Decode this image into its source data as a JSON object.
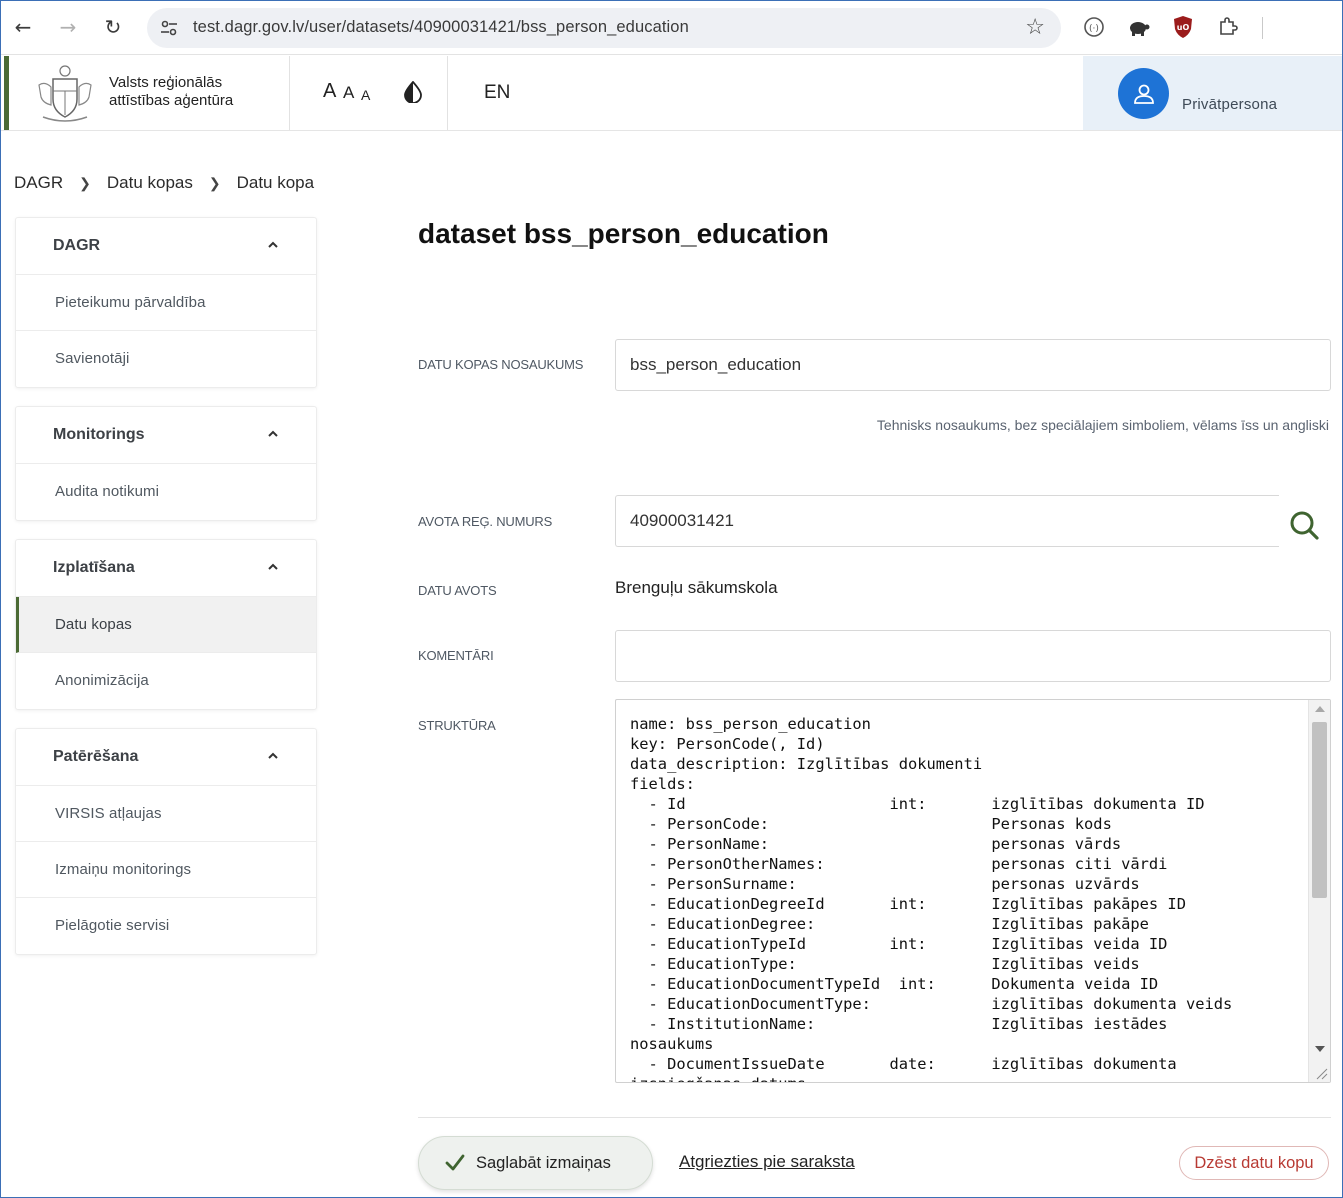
{
  "browser": {
    "url": "test.dagr.gov.lv/user/datasets/40900031421/bss_person_education"
  },
  "header": {
    "org_line1": "Valsts reģionālās",
    "org_line2": "attīstības aģentūra",
    "font_small": "A",
    "font_medium": "A",
    "font_large": "A",
    "language": "EN",
    "user_role": "Privātpersona"
  },
  "breadcrumb": [
    "DAGR",
    "Datu kopas",
    "Datu kopa"
  ],
  "sidebar": {
    "groups": [
      {
        "title": "DAGR",
        "items": [
          "Pieteikumu pārvaldība",
          "Savienotāji"
        ]
      },
      {
        "title": "Monitorings",
        "items": [
          "Audita notikumi"
        ]
      },
      {
        "title": "Izplatīšana",
        "items": [
          "Datu kopas",
          "Anonimizācija"
        ],
        "active": "Datu kopas"
      },
      {
        "title": "Patērēšana",
        "items": [
          "VIRSIS atļaujas",
          "Izmaiņu monitorings",
          "Pielāgotie servisi"
        ]
      }
    ]
  },
  "main": {
    "title": "dataset bss_person_education",
    "name_label": "DATU KOPAS NOSAUKUMS",
    "name_value": "bss_person_education",
    "name_hint": "Tehnisks nosaukums, bez speciālajiem simboliem, vēlams īss un angliski",
    "reg_label": "AVOTA REĢ. NUMURS",
    "reg_value": "40900031421",
    "source_label": "DATU AVOTS",
    "source_value": "Brenguļu sākumskola",
    "comments_label": "KOMENTĀRI",
    "comments_value": "",
    "structure_label": "STRUKTŪRA",
    "structure_text": "name: bss_person_education\nkey: PersonCode(, Id)\ndata_description: Izglītības dokumenti\nfields:\n  - Id                      int:       izglītības dokumenta ID\n  - PersonCode:                        Personas kods\n  - PersonName:                        personas vārds\n  - PersonOtherNames:                  personas citi vārdi\n  - PersonSurname:                     personas uzvārds\n  - EducationDegreeId       int:       Izglītības pakāpes ID\n  - EducationDegree:                   Izglītības pakāpe\n  - EducationTypeId         int:       Izglītības veida ID\n  - EducationType:                     Izglītības veids\n  - EducationDocumentTypeId  int:      Dokumenta veida ID\n  - EducationDocumentType:             izglītības dokumenta veids\n  - InstitutionName:                   Izglītības iestādes\nnosaukums\n  - DocumentIssueDate       date:      izglītības dokumenta\nizsniegšanas datums"
  },
  "actions": {
    "save": "Saglabāt izmaiņas",
    "back": "Atgriezties pie saraksta",
    "delete": "Dzēst datu kopu"
  },
  "colors": {
    "brand_green": "#4b6a34",
    "avatar_blue": "#1e73d6",
    "delete_red": "#b83a33"
  }
}
